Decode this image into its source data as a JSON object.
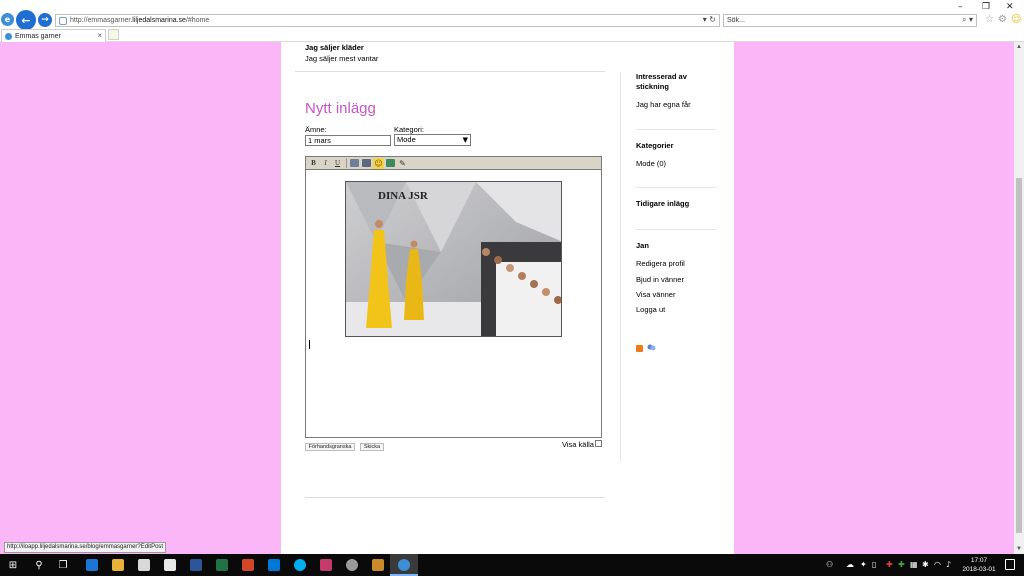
{
  "browser": {
    "url_prefix": "http://emmasgarner.",
    "url_domain": "liljedalsmarina.se",
    "url_suffix": "/#home",
    "address_tools": "▾ ↻",
    "search_placeholder": "Sök...",
    "search_tools": "⌕ ▾",
    "tab_label": "Emmas garner",
    "tab_close": "×",
    "minimize": "–",
    "restore": "❐",
    "close": "✕"
  },
  "previous_post": {
    "title": "Jag säljer kläder",
    "text": "Jag säljer mest vantar"
  },
  "new_post": {
    "heading": "Nytt inlägg",
    "subject_label": "Ämne:",
    "subject_value": "1 mars",
    "category_label": "Kategori:",
    "category_value": "Mode",
    "category_arrow": "▼",
    "toolbar": {
      "bold": "B",
      "italic": "I",
      "underline": "U"
    },
    "image_caption": "DINA JSR",
    "preview_label": "Förhandsgranska",
    "send_label": "Skicka",
    "show_source_label": "Visa källa"
  },
  "sidebar": {
    "interest_heading": "Intresserad av stickning",
    "interest_text": "Jag har egna får",
    "categories_heading": "Kategorier",
    "categories_item": "Mode (0)",
    "earlier_heading": "Tidigare inlägg",
    "user_heading": "Jan",
    "links": [
      "Redigera profil",
      "Bjud in vänner",
      "Visa vänner",
      "Logga ut"
    ]
  },
  "status_url": "http://iloapp.liljedalsmarina.se/blog/emmasgarner?EditPost",
  "taskbar": {
    "time": "17:07",
    "date": "2018-03-01"
  },
  "colors": {
    "page_background": "#fbb6f8",
    "heading_accent": "#c457c2"
  }
}
